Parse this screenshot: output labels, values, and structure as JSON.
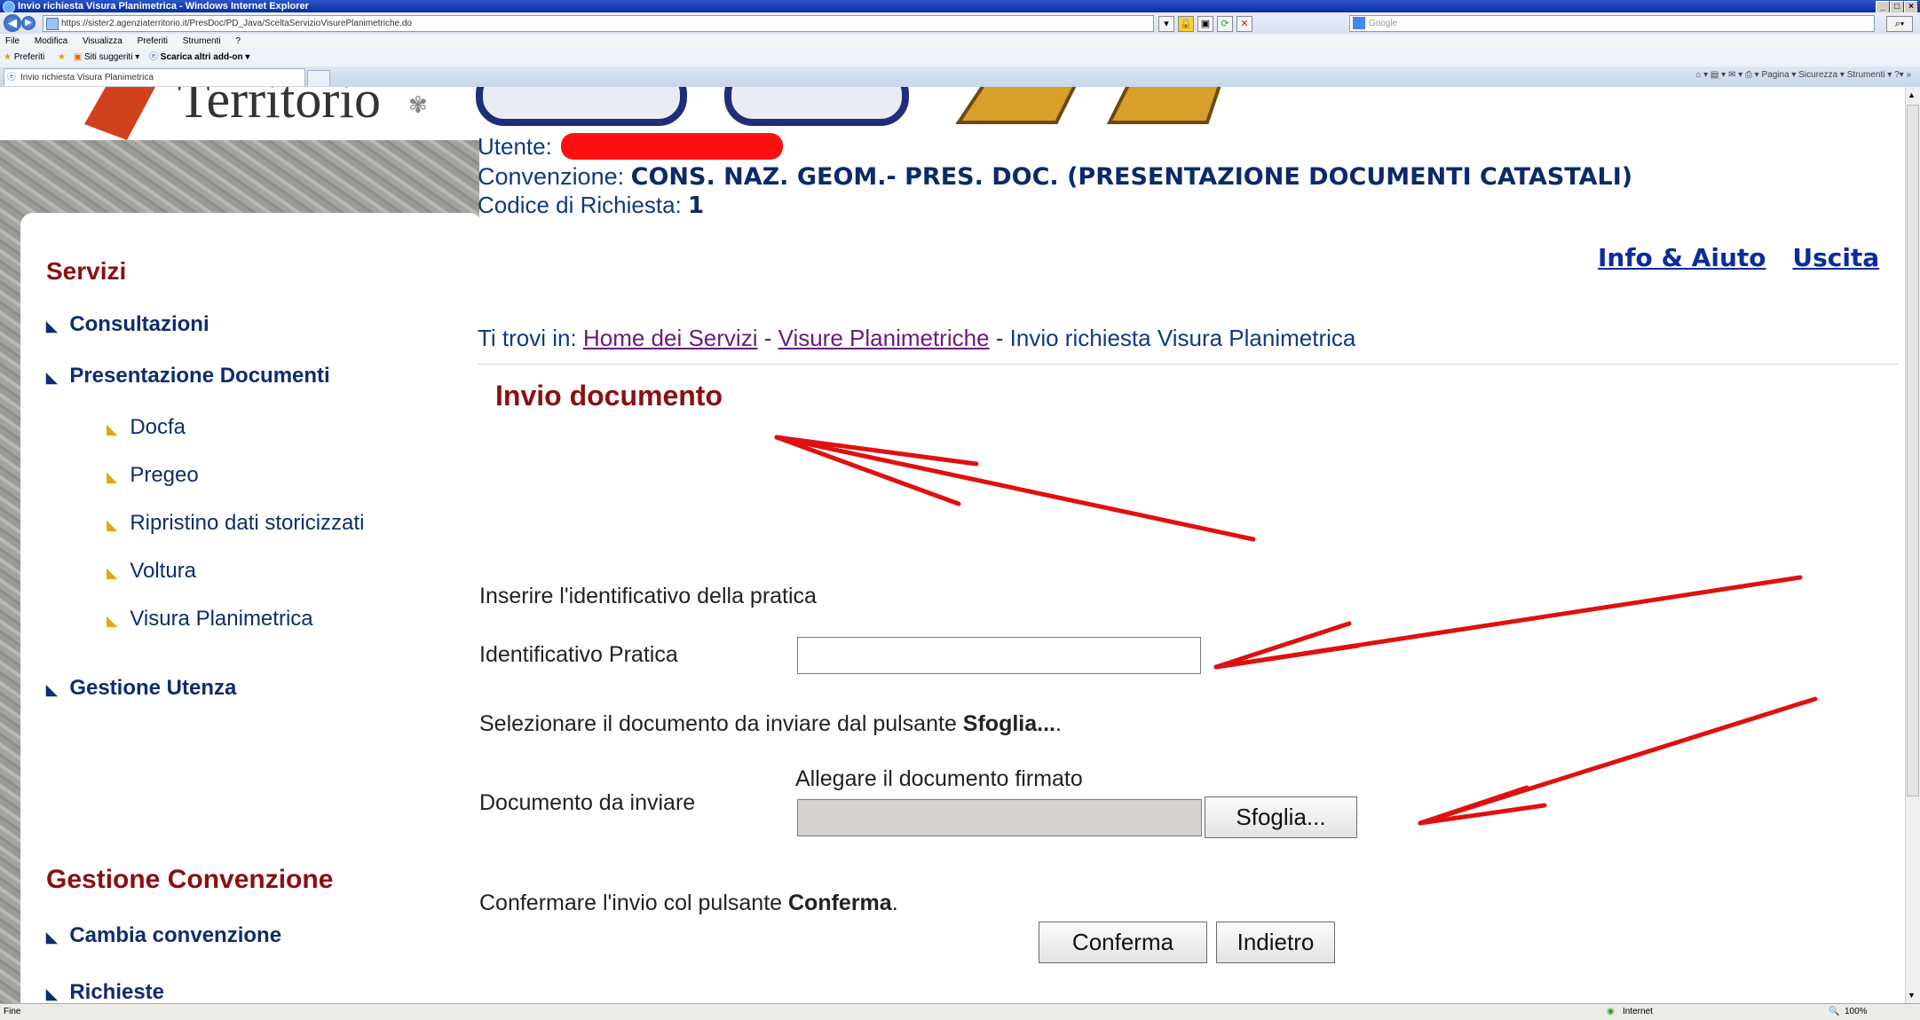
{
  "browser": {
    "window_title": "Invio richiesta Visura Planimetrica - Windows Internet Explorer",
    "url": "https://sister2.agenziaterritorio.it/PresDoc/PD_Java/SceltaServizioVisurePlanimetriche.do",
    "search_placeholder": "Google",
    "menu": [
      "File",
      "Modifica",
      "Visualizza",
      "Preferiti",
      "Strumenti",
      "?"
    ],
    "favorites": {
      "label": "Preferiti",
      "suggested": "Siti suggeriti ▾",
      "addon": "Scarica altri add-on ▾"
    },
    "tab_title": "Invio richiesta Visura Planimetrica",
    "command_bar": "Pagina ▾   Sicurezza ▾   Strumenti ▾",
    "status_left": "Fine",
    "status_zone": "Internet",
    "zoom": "100%"
  },
  "header": {
    "logo_text": "Territorio"
  },
  "sidebar": {
    "title": "Servizi",
    "items": [
      {
        "label": "Consultazioni"
      },
      {
        "label": "Presentazione Documenti"
      }
    ],
    "subitems": [
      {
        "label": "Docfa"
      },
      {
        "label": "Pregeo"
      },
      {
        "label": "Ripristino dati storicizzati"
      },
      {
        "label": "Voltura"
      },
      {
        "label": "Visura Planimetrica"
      }
    ],
    "item_gestione": "Gestione Utenza",
    "section2_title": "Gestione Convenzione",
    "section2_items": [
      {
        "label": "Cambia convenzione"
      },
      {
        "label": "Richieste"
      }
    ]
  },
  "user": {
    "utente_label": "Utente:",
    "convenzione_label": "Convenzione:",
    "convenzione_value": "CONS. NAZ. GEOM.- PRES. DOC. (PRESENTAZIONE DOCUMENTI CATASTALI)",
    "codice_label": "Codice di Richiesta:",
    "codice_value": "1"
  },
  "toplinks": {
    "help": "Info & Aiuto",
    "exit": "Uscita"
  },
  "breadcrumb": {
    "prefix": "Ti trovi in:",
    "home": "Home dei Servizi",
    "sep": " - ",
    "section": "Visure Planimetriche",
    "current": "Invio richiesta Visura Planimetrica"
  },
  "form": {
    "title": "Invio documento",
    "instr1": "Inserire l'identificativo della pratica",
    "id_label": "Identificativo Pratica",
    "id_value": "",
    "instr2_pre": "Selezionare il documento da inviare dal pulsante ",
    "instr2_bold": "Sfoglia...",
    "instr2_post": ".",
    "attach_label": "Allegare il documento firmato",
    "doc_label": "Documento da inviare",
    "browse_button": "Sfoglia...",
    "instr3_pre": "Confermare l'invio col pulsante ",
    "instr3_bold": "Conferma",
    "instr3_post": ".",
    "confirm_button": "Conferma",
    "back_button": "Indietro"
  },
  "colors": {
    "accent_red": "#8b0f12",
    "navy": "#0e2d6e",
    "annotation_red": "#e01010"
  }
}
